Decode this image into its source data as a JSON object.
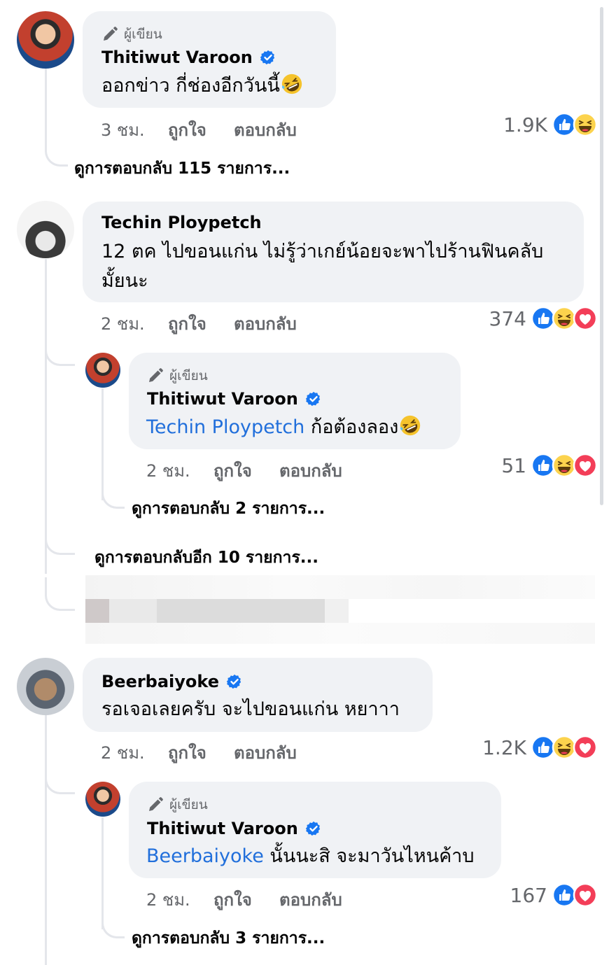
{
  "colors": {
    "mention": "#216fdb",
    "bubble": "#f0f2f5",
    "meta": "#65676b",
    "like_blue": "#1877f2",
    "love_red": "#f33e58",
    "haha_yellow": "#fcd34d"
  },
  "icons": {
    "author_badge": "pencil-icon",
    "verified": "verified-badge-icon",
    "reactions": [
      "like-reaction-icon",
      "haha-reaction-icon",
      "love-reaction-icon"
    ]
  },
  "comments": [
    {
      "author_badge": "ผู้เขียน",
      "name": "Thitiwut Varoon",
      "text": "ออกข่าว กี่ช่องอีกวันนี้",
      "time": "3 ชม.",
      "like": "ถูกใจ",
      "reply": "ตอบกลับ",
      "reaction_count": "1.9K",
      "view_replies": "ดูการตอบกลับ 115 รายการ..."
    },
    {
      "name": "Techin Ploypetch",
      "text_line1": "12 ตค ไปขอนแก่น ไม่รู้ว่าเกย์น้อยจะพาไปร้านฟินคลับ",
      "text_line2": "มั้ยนะ",
      "time": "2 ชม.",
      "like": "ถูกใจ",
      "reply": "ตอบกลับ",
      "reaction_count": "374",
      "reply_item": {
        "author_badge": "ผู้เขียน",
        "name": "Thitiwut Varoon",
        "mention": "Techin Ploypetch",
        "text": "ก้อต้องลอง",
        "time": "2 ชม.",
        "like": "ถูกใจ",
        "reply": "ตอบกลับ",
        "reaction_count": "51",
        "view_replies": "ดูการตอบกลับ 2 รายการ..."
      },
      "view_more": "ดูการตอบกลับอีก 10 รายการ..."
    },
    {
      "name": "Beerbaiyoke",
      "text": "รอเจอเลยครับ จะไปขอนแก่น หยาาา",
      "time": "2 ชม.",
      "like": "ถูกใจ",
      "reply": "ตอบกลับ",
      "reaction_count": "1.2K",
      "reply_item": {
        "author_badge": "ผู้เขียน",
        "name": "Thitiwut Varoon",
        "mention": "Beerbaiyoke",
        "text": "นั้นนะสิ จะมาวันไหนค้าบ",
        "time": "2 ชม.",
        "like": "ถูกใจ",
        "reply": "ตอบกลับ",
        "reaction_count": "167",
        "view_replies": "ดูการตอบกลับ 3 รายการ..."
      }
    }
  ]
}
